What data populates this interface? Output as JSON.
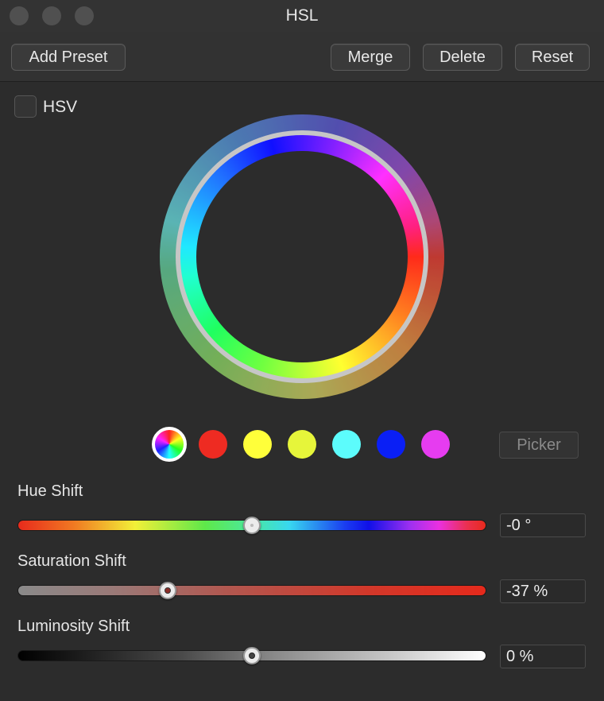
{
  "window": {
    "title": "HSL"
  },
  "toolbar": {
    "add_preset_label": "Add Preset",
    "merge_label": "Merge",
    "delete_label": "Delete",
    "reset_label": "Reset"
  },
  "hsv": {
    "label": "HSV",
    "checked": false
  },
  "swatches": [
    {
      "name": "all-colors",
      "color": "multicolor",
      "selected": true
    },
    {
      "name": "red",
      "color": "#ee2b22"
    },
    {
      "name": "yellow",
      "color": "#ffff3a"
    },
    {
      "name": "yellow-green",
      "color": "#e6f53a"
    },
    {
      "name": "cyan",
      "color": "#5cfcfc"
    },
    {
      "name": "blue",
      "color": "#0a1ff5"
    },
    {
      "name": "magenta",
      "color": "#e63cf0"
    }
  ],
  "picker_label": "Picker",
  "sliders": {
    "hue": {
      "label": "Hue Shift",
      "value": "-0 °",
      "position": 0.5
    },
    "saturation": {
      "label": "Saturation Shift",
      "value": "-37 %",
      "position": 0.32
    },
    "luminosity": {
      "label": "Luminosity Shift",
      "value": "0 %",
      "position": 0.5
    }
  }
}
